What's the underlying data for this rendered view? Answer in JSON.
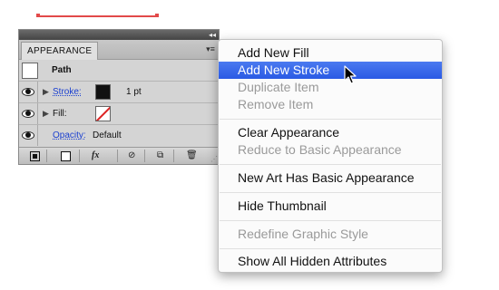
{
  "panel": {
    "tab_label": "APPEARANCE",
    "collapse_glyph": "◂◂",
    "menu_glyph": "▾≡",
    "object_label": "Path",
    "stroke_label": "Stroke:",
    "stroke_value": "1 pt",
    "fill_label": "Fill:",
    "opacity_label": "Opacity:",
    "opacity_value": "Default",
    "bottom_fx": "fx"
  },
  "menu": {
    "items": [
      {
        "label": "Add New Fill",
        "enabled": true
      },
      {
        "label": "Add New Stroke",
        "enabled": true,
        "highlighted": true
      },
      {
        "label": "Duplicate Item",
        "enabled": false
      },
      {
        "label": "Remove Item",
        "enabled": false
      },
      {
        "label": "Clear Appearance",
        "enabled": true
      },
      {
        "label": "Reduce to Basic Appearance",
        "enabled": false
      },
      {
        "label": "New Art Has Basic Appearance",
        "enabled": true
      },
      {
        "label": "Hide Thumbnail",
        "enabled": true
      },
      {
        "label": "Redefine Graphic Style",
        "enabled": false
      },
      {
        "label": "Show All Hidden Attributes",
        "enabled": true
      }
    ]
  },
  "colors": {
    "highlight": "#2a5ae4",
    "canvas_line": "#e24a4a",
    "link": "#1a3fd0"
  }
}
